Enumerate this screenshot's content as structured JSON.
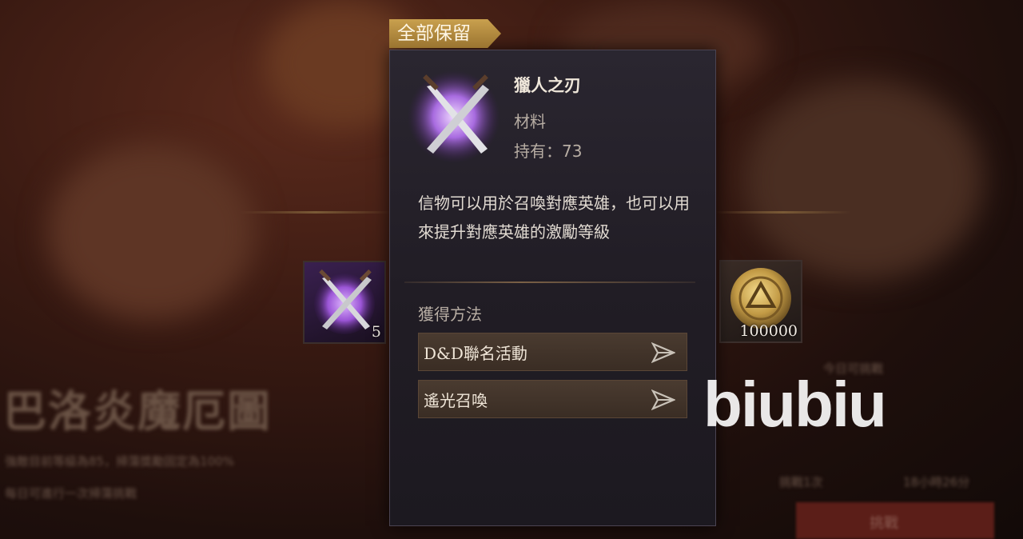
{
  "tag": {
    "keep_all": "全部保留"
  },
  "item": {
    "name": "獵人之刃",
    "type": "材料",
    "owned": "持有：73",
    "description": "信物可以用於召喚對應英雄，也可以用來提升對應英雄的激勵等級"
  },
  "obtain": {
    "title": "獲得方法",
    "sources": [
      {
        "label": "D&D聯名活動",
        "icon": "send-arrow-icon"
      },
      {
        "label": "遙光召喚",
        "icon": "send-arrow-icon"
      }
    ]
  },
  "side_items": {
    "left": {
      "icon": "crossed-blades-icon",
      "count": "5"
    },
    "right": {
      "icon": "gold-coin-icon",
      "count": "100000"
    }
  },
  "background": {
    "title": "巴洛炎魔厄圖",
    "desc_line1": "強敵目前等級為85，掃蕩獎勵固定為100%",
    "desc_line2": "每日可進行一次掃蕩挑戰",
    "right_line1": "今日可挑戰",
    "right_line2": "挑戰1次",
    "right_line3": "18小時26分",
    "button": "挑戰"
  },
  "watermark": "biubiu",
  "colors": {
    "tag_gold": "#c9a04e",
    "popup_bg": "#221e27",
    "arcane_purple": "#a86be0"
  }
}
